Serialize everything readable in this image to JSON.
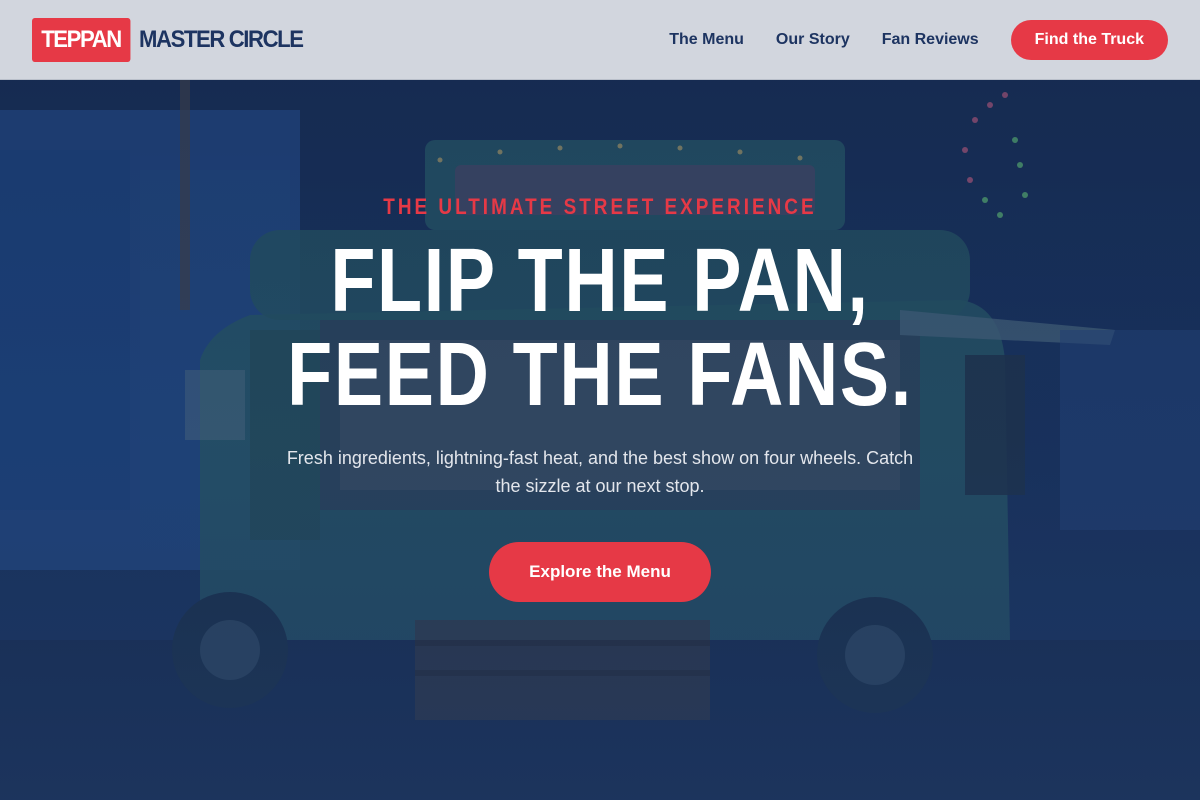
{
  "brand": {
    "logo_box": "TEPPAN",
    "logo_text": "MASTER CIRCLE"
  },
  "nav": {
    "items": [
      {
        "label": "The Menu"
      },
      {
        "label": "Our Story"
      },
      {
        "label": "Fan Reviews"
      }
    ],
    "cta_label": "Find the Truck"
  },
  "hero": {
    "eyebrow": "THE ULTIMATE STREET EXPERIENCE",
    "headline_line1": "FLIP THE PAN,",
    "headline_line2": "FEED THE FANS.",
    "subtext": "Fresh ingredients, lightning-fast heat, and the best show on four wheels. Catch the sizzle at our next stop.",
    "cta_label": "Explore the Menu",
    "background_image": "food-truck-night-photo"
  },
  "colors": {
    "accent": "#e63946",
    "navy": "#1d3461",
    "header_bg": "#d2d6de",
    "white": "#ffffff"
  }
}
